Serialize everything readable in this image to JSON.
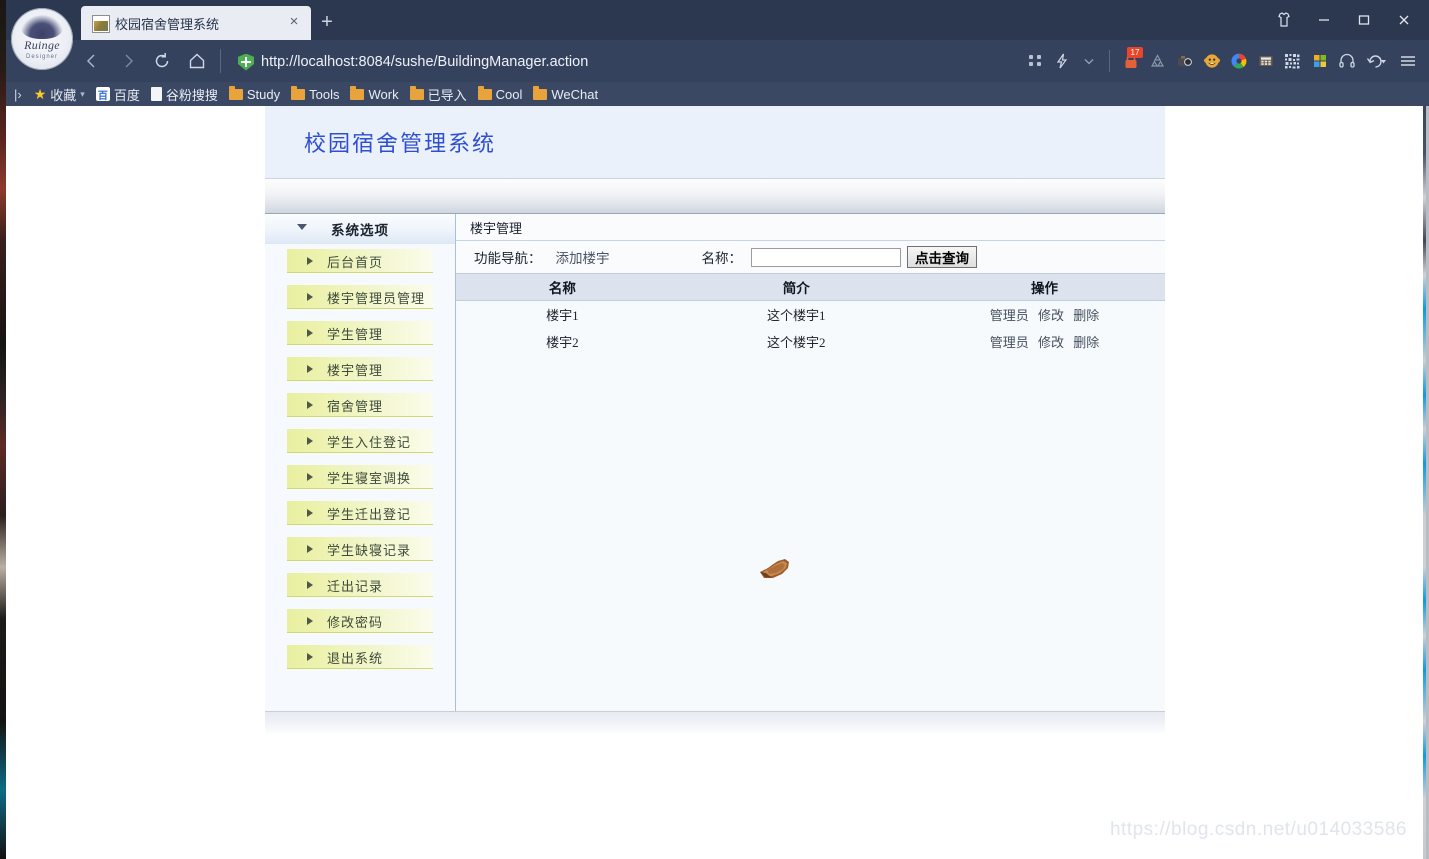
{
  "browser": {
    "tab": {
      "title": "校园宿舍管理系统",
      "close_label": "×",
      "favicon_name": "site-favicon"
    },
    "newtab_label": "+",
    "window_controls": [
      {
        "name": "skin-theme-icon",
        "label": ""
      },
      {
        "name": "minimize-button",
        "label": ""
      },
      {
        "name": "maximize-button",
        "label": ""
      },
      {
        "name": "close-button",
        "label": ""
      }
    ],
    "nav": {
      "back_label": "",
      "forward_label": "",
      "reload_label": "",
      "home_label": ""
    },
    "url": "http://localhost:8084/sushe/BuildingManager.action",
    "security_icon": "green-shield-plus",
    "toolbar_icons": [
      {
        "name": "qr-grid-icon",
        "badge": ""
      },
      {
        "name": "lightning-icon",
        "badge": ""
      },
      {
        "name": "chevron-down-icon",
        "badge": ""
      },
      {
        "name": "lock-icon",
        "badge": "17"
      },
      {
        "name": "recycle-icon",
        "badge": ""
      },
      {
        "name": "camera-icon",
        "badge": ""
      },
      {
        "name": "monkey-face-icon",
        "badge": ""
      },
      {
        "name": "color-wheel-icon",
        "badge": ""
      },
      {
        "name": "calculator-icon",
        "badge": ""
      },
      {
        "name": "qrcode-icon",
        "badge": ""
      },
      {
        "name": "windows-grid-icon",
        "badge": ""
      },
      {
        "name": "headphones-icon",
        "badge": ""
      },
      {
        "name": "undo-arrow-icon",
        "badge": ""
      },
      {
        "name": "hamburger-menu-icon",
        "badge": ""
      }
    ],
    "bookmarks": {
      "expand_label": "|›",
      "items": [
        {
          "label": "收藏",
          "icon": "star-icon",
          "has_chevron": true
        },
        {
          "label": "百度",
          "icon": "baidu-icon",
          "has_chevron": false
        },
        {
          "label": "谷粉搜搜",
          "icon": "page-icon",
          "has_chevron": false
        },
        {
          "label": "Study",
          "icon": "folder-icon",
          "has_chevron": false
        },
        {
          "label": "Tools",
          "icon": "folder-icon",
          "has_chevron": false
        },
        {
          "label": "Work",
          "icon": "folder-icon",
          "has_chevron": false
        },
        {
          "label": "已导入",
          "icon": "folder-icon",
          "has_chevron": false
        },
        {
          "label": "Cool",
          "icon": "folder-icon",
          "has_chevron": false
        },
        {
          "label": "WeChat",
          "icon": "folder-icon",
          "has_chevron": false
        }
      ]
    }
  },
  "site": {
    "title": "校园宿舍管理系统",
    "sidebar": {
      "header": "系统选项",
      "items": [
        {
          "label": "后台首页"
        },
        {
          "label": "楼宇管理员管理"
        },
        {
          "label": "学生管理"
        },
        {
          "label": "楼宇管理"
        },
        {
          "label": "宿舍管理"
        },
        {
          "label": "学生入住登记"
        },
        {
          "label": "学生寝室调换"
        },
        {
          "label": "学生迁出登记"
        },
        {
          "label": "学生缺寝记录"
        },
        {
          "label": "迁出记录"
        },
        {
          "label": "修改密码"
        },
        {
          "label": "退出系统"
        }
      ]
    },
    "content": {
      "panel_title": "楼宇管理",
      "toolbar": {
        "nav_label": "功能导航：",
        "add_link": "添加楼宇",
        "name_label": "名称：",
        "search_value": "",
        "search_placeholder": "",
        "search_button": "点击查询"
      },
      "table": {
        "columns": [
          "名称",
          "简介",
          "操作"
        ],
        "rows": [
          {
            "name": "楼宇1",
            "intro": "这个楼宇1",
            "ops": [
              "管理员",
              "修改",
              "删除"
            ]
          },
          {
            "name": "楼宇2",
            "intro": "这个楼宇2",
            "ops": [
              "管理员",
              "修改",
              "删除"
            ]
          }
        ]
      }
    }
  },
  "watermark": "https://blog.csdn.net/u014033586",
  "colors": {
    "chrome_bg": "#2e3b55",
    "nav_bg": "#35425e",
    "bookmark_bg": "#3b4864",
    "site_header_bg": "#eaf1fb",
    "site_title": "#2f4fd0",
    "menu_gradient_start": "#e8ef9f",
    "table_header_bg": "#dce3ef",
    "badge_red": "#e8452a"
  }
}
